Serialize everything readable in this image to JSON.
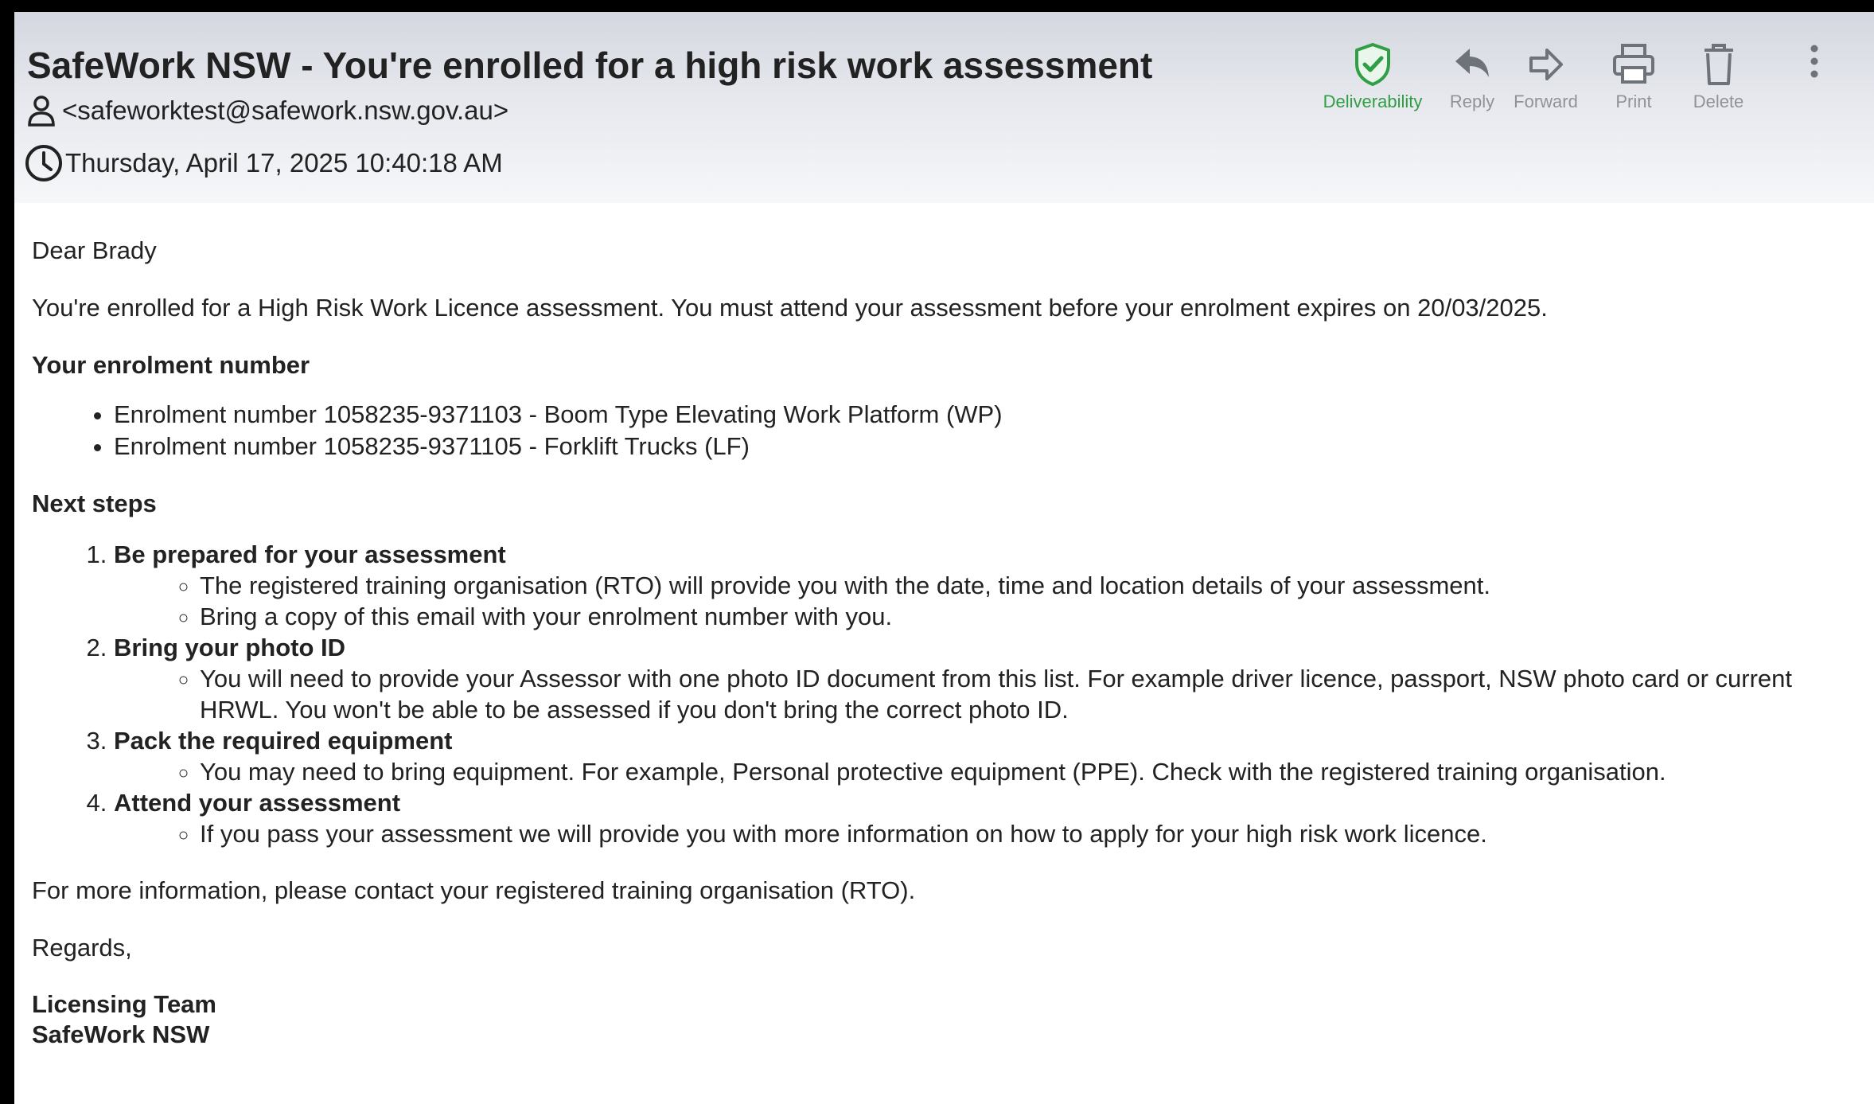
{
  "email": {
    "subject": "SafeWork NSW - You're enrolled for a high risk work assessment",
    "sender": "<safeworktest@safework.nsw.gov.au>",
    "date": "Thursday, April 17, 2025 10:40:18 AM"
  },
  "toolbar": {
    "deliverability": "Deliverability",
    "reply": "Reply",
    "forward": "Forward",
    "print": "Print",
    "delete": "Delete"
  },
  "colors": {
    "deliverability": "#2f9e44",
    "icon": "#8a8f96"
  },
  "icons": {
    "sender": "person-icon",
    "date": "clock-icon",
    "deliverability": "shield-check-icon",
    "reply": "reply-arrow-icon",
    "forward": "forward-arrow-icon",
    "print": "printer-icon",
    "delete": "trash-icon",
    "more": "kebab-menu-icon"
  },
  "body": {
    "greeting": "Dear Brady",
    "intro": "You're enrolled for a High Risk Work Licence assessment. You must attend your assessment before your enrolment expires on 20/03/2025.",
    "enrolment_heading": "Your enrolment number",
    "enrolments": [
      "Enrolment number 1058235-9371103 - Boom Type Elevating Work Platform (WP)",
      "Enrolment number 1058235-9371105 - Forklift Trucks (LF)"
    ],
    "next_steps_heading": "Next steps",
    "steps": [
      {
        "title": "Be prepared for your assessment",
        "items": [
          "The registered training organisation (RTO) will provide you with the date, time and location details of your assessment.",
          "Bring a copy of this email with your enrolment number with you."
        ]
      },
      {
        "title": "Bring your photo ID",
        "items": [
          "You will need to provide your Assessor with one photo ID document from this list. For example driver licence, passport, NSW photo card or current HRWL. You won't be able to be assessed if you don't bring the correct photo ID."
        ]
      },
      {
        "title": "Pack the required equipment",
        "items": [
          "You may need to bring equipment. For example, Personal protective equipment (PPE). Check with the registered training organisation."
        ]
      },
      {
        "title": "Attend your assessment",
        "items": [
          "If you pass your assessment we will provide you with more information on how to apply for your high risk work licence."
        ]
      }
    ],
    "more_info": "For more information, please contact your registered training organisation (RTO).",
    "regards": "Regards,",
    "signature_team": "Licensing Team",
    "signature_org": "SafeWork NSW"
  }
}
